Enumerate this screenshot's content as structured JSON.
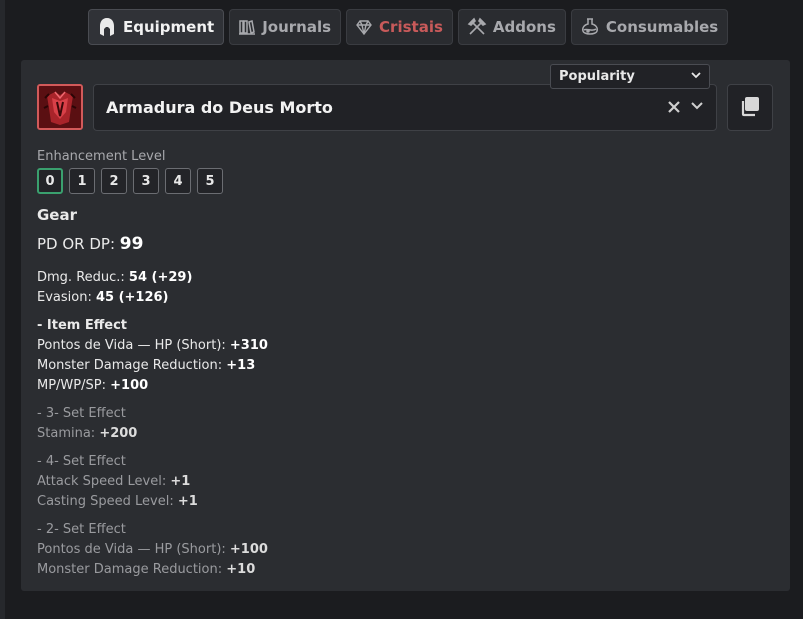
{
  "tabs": [
    {
      "label": "Equipment",
      "icon": "helmet-icon"
    },
    {
      "label": "Journals",
      "icon": "journals-icon"
    },
    {
      "label": "Cristais",
      "icon": "crystal-icon"
    },
    {
      "label": "Addons",
      "icon": "axes-icon"
    },
    {
      "label": "Consumables",
      "icon": "potion-icon"
    }
  ],
  "sort": {
    "value": "Popularity"
  },
  "item": {
    "name": "Armadura do Deus Morto",
    "icon": "armor-icon"
  },
  "enhancement": {
    "label": "Enhancement Level",
    "levels": [
      "0",
      "1",
      "2",
      "3",
      "4",
      "5"
    ],
    "selected": "0"
  },
  "stats": {
    "section": "Gear",
    "pd_label": "PD OR DP: ",
    "pd_value": "99",
    "dmg_label": "Dmg. Reduc.: ",
    "dmg_value": "54 (+29)",
    "evasion_label": "Evasion: ",
    "evasion_value": "45 (+126)"
  },
  "item_effect": {
    "title": "- Item Effect",
    "lines": [
      {
        "label": "Pontos de Vida — HP (Short): ",
        "value": "+310"
      },
      {
        "label": "Monster Damage Reduction: ",
        "value": "+13"
      },
      {
        "label": "MP/WP/SP: ",
        "value": "+100"
      }
    ]
  },
  "set_effects": [
    {
      "title": "- 3- Set Effect",
      "lines": [
        {
          "label": "Stamina: ",
          "value": "+200"
        }
      ]
    },
    {
      "title": "- 4- Set Effect",
      "lines": [
        {
          "label": "Attack Speed Level: ",
          "value": "+1"
        },
        {
          "label": "Casting Speed Level: ",
          "value": "+1"
        }
      ]
    },
    {
      "title": "- 2- Set Effect",
      "lines": [
        {
          "label": "Pontos de Vida — HP (Short): ",
          "value": "+100"
        },
        {
          "label": "Monster Damage Reduction: ",
          "value": "+10"
        }
      ]
    }
  ],
  "colors": {
    "accent_selected": "#3aa06e",
    "cristais_tab": "#c85a5a",
    "icon_border": "#d25a5a"
  }
}
